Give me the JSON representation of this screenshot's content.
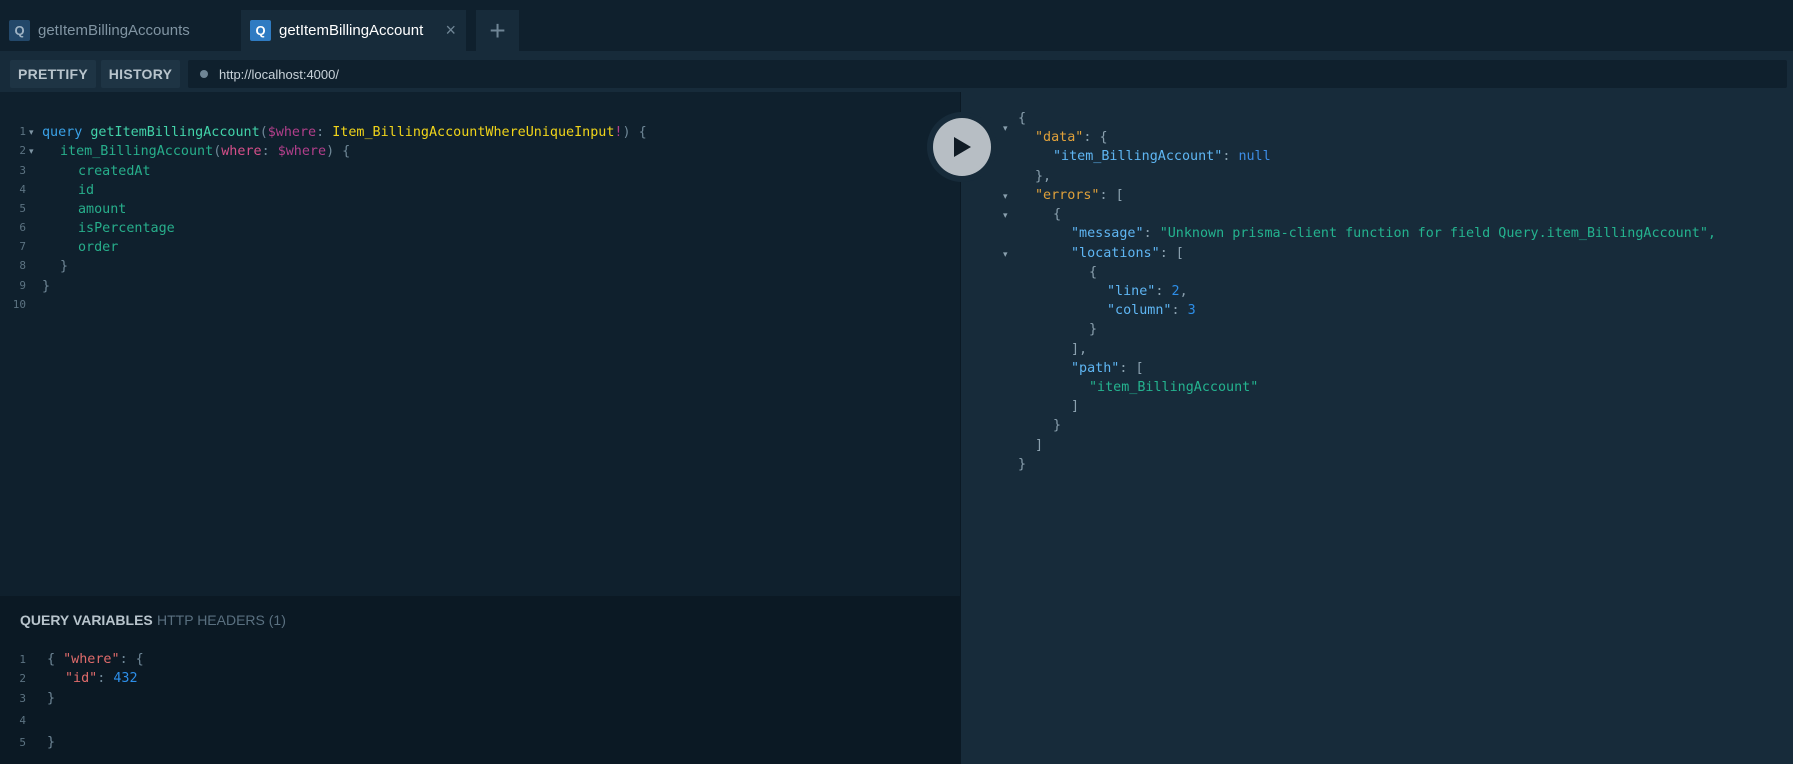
{
  "tabs": [
    {
      "badge": "Q",
      "label": "getItemBillingAccounts"
    },
    {
      "badge": "Q",
      "label": "getItemBillingAccount",
      "close": "×"
    }
  ],
  "add_tab": "+",
  "toolbar": {
    "prettify": "PRETTIFY",
    "history": "HISTORY",
    "url": "http://localhost:4000/"
  },
  "editor": {
    "line_numbers": [
      "1",
      "2",
      "3",
      "4",
      "5",
      "6",
      "7",
      "8",
      "9",
      "10"
    ],
    "lines": [
      [
        "query",
        " ",
        "getItemBillingAccount",
        "(",
        "$where",
        ": ",
        "Item_BillingAccountWhereUniqueInput",
        "!",
        ") {"
      ],
      [
        "item_BillingAccount",
        "(",
        "where",
        ": ",
        "$where",
        ") {"
      ],
      [
        "createdAt"
      ],
      [
        "id"
      ],
      [
        "amount"
      ],
      [
        "isPercentage"
      ],
      [
        "order"
      ],
      [
        "}"
      ],
      [
        "}"
      ]
    ]
  },
  "variables": {
    "tab_active": "QUERY VARIABLES",
    "tab_inactive": "HTTP HEADERS (1)",
    "line_numbers": [
      "1",
      "2",
      "3",
      "4",
      "5"
    ],
    "l1_open": "{ ",
    "l1_key": "\"where\"",
    "l1_rest": ": {",
    "l2_key": "\"id\"",
    "l2_colon": ": ",
    "l2_val": "432",
    "l3": "}",
    "l5": "}"
  },
  "result": {
    "open": "{",
    "data_key": "\"data\"",
    "brace_open": ": {",
    "item_key": "\"item_BillingAccount\"",
    "colon": ": ",
    "null_val": "null",
    "data_close": "},",
    "errors_key": "\"errors\"",
    "arr_open": ": [",
    "obj_open": "{",
    "message_key": "\"message\"",
    "message_val": "\"Unknown prisma-client function for field Query.item_BillingAccount\",",
    "locations_key": "\"locations\"",
    "loc_obj_open": "{",
    "line_key": "\"line\"",
    "line_val": "2",
    "comma": ",",
    "column_key": "\"column\"",
    "column_val": "3",
    "loc_obj_close": "}",
    "loc_arr_close": "],",
    "path_key": "\"path\"",
    "path_val": "\"item_BillingAccount\"",
    "path_close": "]",
    "err_obj_close": "}",
    "errors_close": "]",
    "close": "}"
  },
  "colors": {
    "accent": "#2f7bc2",
    "keyword": "#3aa2e8",
    "type": "#f0d41a",
    "field": "#27ae8b",
    "string_result": "#24b38f"
  },
  "icons": [
    "query-badge-icon",
    "close-icon",
    "plus-icon",
    "status-dot-icon",
    "play-icon",
    "fold-arrow-icon"
  ]
}
